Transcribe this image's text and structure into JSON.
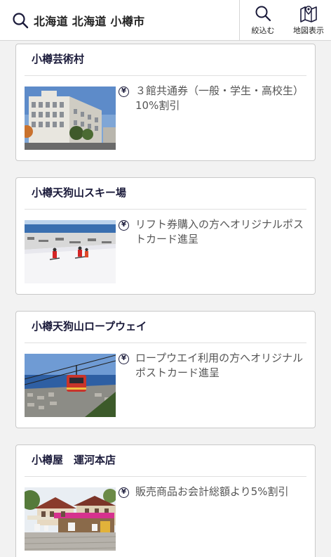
{
  "header": {
    "search_query": "北海道 北海道 小樽市",
    "filter_label": "絞込む",
    "map_label": "地図表示"
  },
  "cards": [
    {
      "title": "小樽芸術村",
      "benefit": "３館共通券（一般・学生・高校生）10%割引",
      "image_icon": "building-photo"
    },
    {
      "title": "小樽天狗山スキー場",
      "benefit": "リフト券購入の方へオリジナルポストカード進呈",
      "image_icon": "ski-slope-photo"
    },
    {
      "title": "小樽天狗山ロープウェイ",
      "benefit": "ロープウエイ利用の方へオリジナルポストカード進呈",
      "image_icon": "ropeway-photo"
    },
    {
      "title": "小樽屋　運河本店",
      "benefit": "販売商品お会計総額より5%割引",
      "image_icon": "shop-photo"
    }
  ],
  "yen_symbol": "¥",
  "colors": {
    "accent": "#1a1a3a",
    "background": "#f2f2f2",
    "card_border": "#c9c9c9",
    "benefit_text": "#555555"
  }
}
